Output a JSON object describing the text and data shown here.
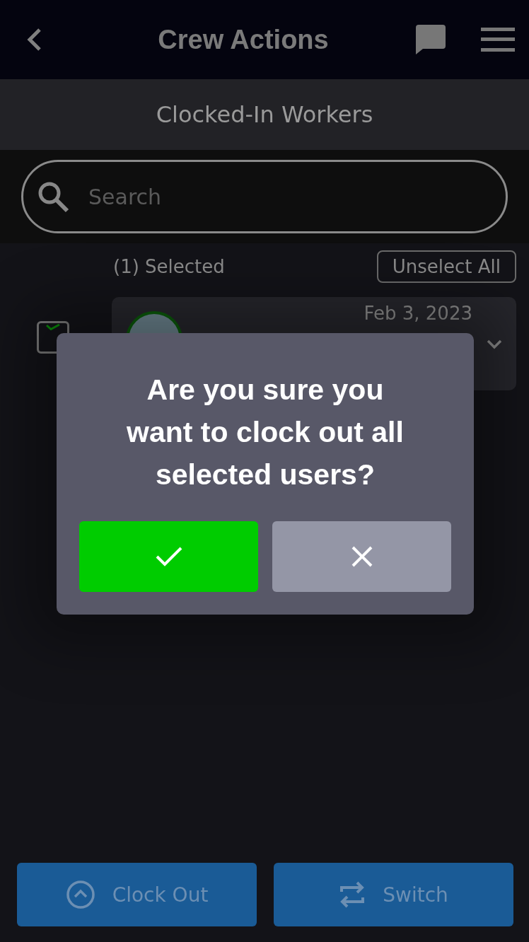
{
  "header": {
    "title": "Crew Actions"
  },
  "section_title": "Clocked-In Workers",
  "search": {
    "placeholder": "Search"
  },
  "selection": {
    "count_label": "(1) Selected",
    "unselect_button": "Unselect All"
  },
  "workers": [
    {
      "selected": true,
      "date": "Feb 3, 2023"
    }
  ],
  "dialog": {
    "message": "Are you sure you want to clock out all selected users?"
  },
  "actions": [
    {
      "kind": "clock-out",
      "label": "Clock Out"
    },
    {
      "kind": "switch",
      "label": "Switch"
    }
  ]
}
